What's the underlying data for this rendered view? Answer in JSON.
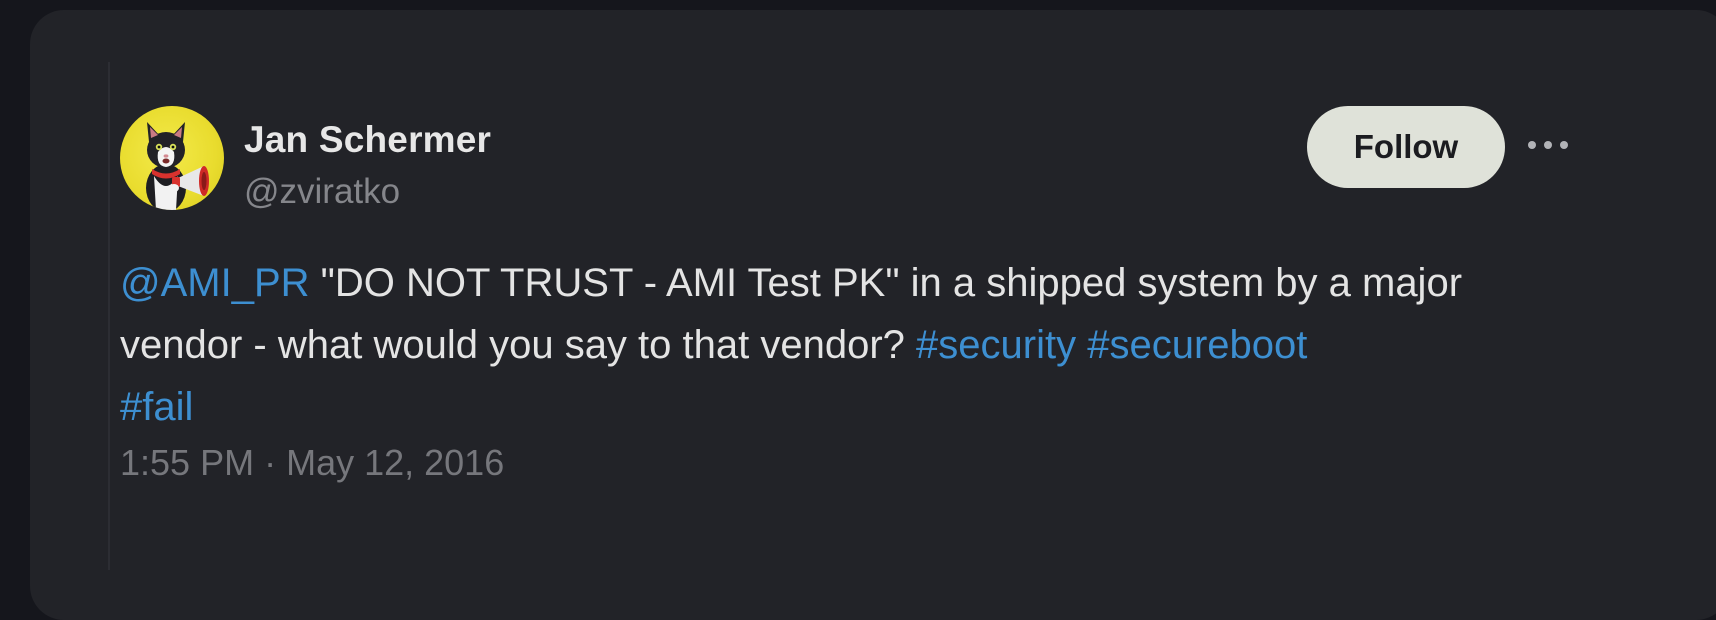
{
  "tweet": {
    "author_name": "Jan Schermer",
    "author_handle": "@zviratko",
    "follow_label": "Follow",
    "mention": "@AMI_PR",
    "text_part1": " \"DO NOT TRUST - AMI Test PK\" in a shipped system by a major",
    "text_part2": "vendor - what would you say to that vendor? ",
    "hashtags": [
      "#security",
      "#secureboot",
      "#fail"
    ],
    "time": "1:55 PM",
    "separator": " · ",
    "date": "May 12, 2016"
  },
  "icons": {
    "avatar": "cat-with-megaphone-avatar",
    "more": "more-options-icon"
  },
  "colors": {
    "background": "#15161c",
    "card": "#222328",
    "link": "#3d8fd1",
    "follow_button": "#dfe2d9",
    "avatar_bg": "#e9dc2e"
  }
}
